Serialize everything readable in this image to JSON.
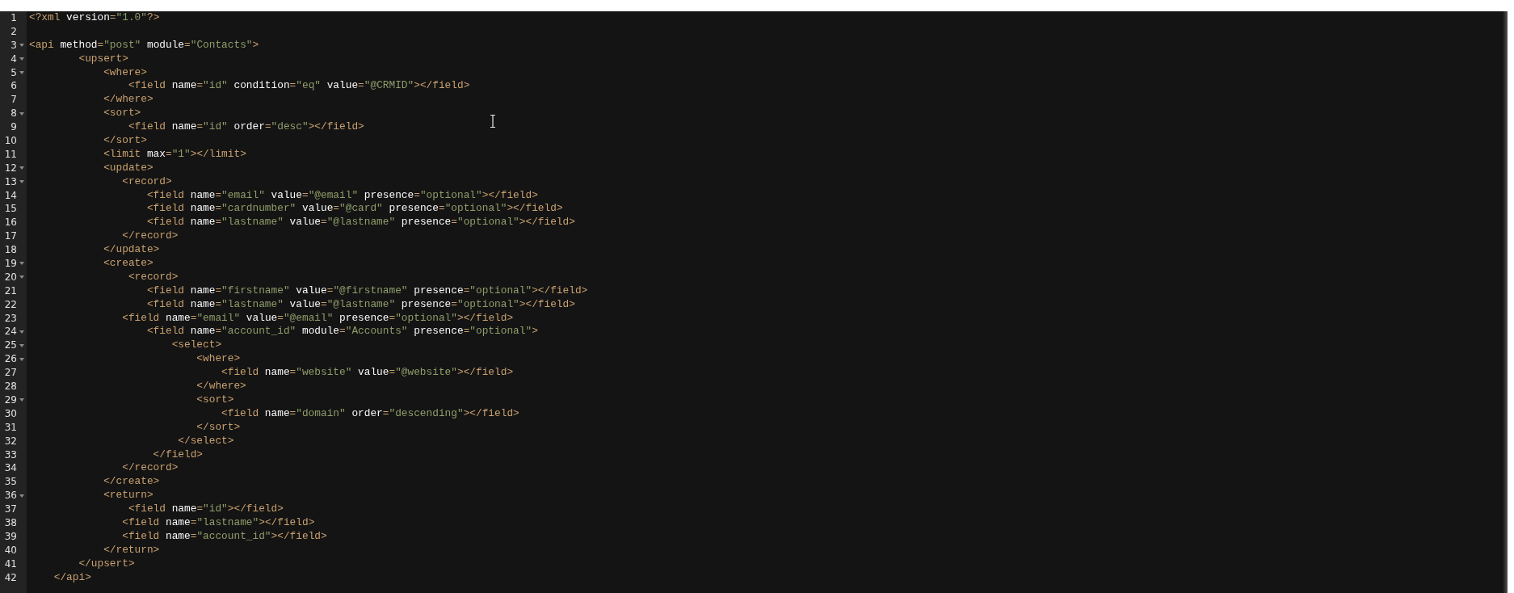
{
  "editor": {
    "lines": [
      {
        "number": "1",
        "text": "<?xml version=\"1.0\"?>",
        "foldable": false
      },
      {
        "number": "2",
        "foldable": false
      },
      {
        "number": "3",
        "text": "<api method=\"post\" module=\"Contacts\">",
        "foldable": true
      },
      {
        "number": "4",
        "text": "        <upsert>",
        "foldable": true
      },
      {
        "number": "5",
        "text": "            <where>",
        "foldable": true
      },
      {
        "number": "6",
        "text": "                <field name=\"id\" condition=\"eq\" value=\"@CRMID\"></field>",
        "foldable": false
      },
      {
        "number": "7",
        "text": "            </where>",
        "foldable": false
      },
      {
        "number": "8",
        "text": "            <sort>",
        "foldable": true
      },
      {
        "number": "9",
        "text": "                <field name=\"id\" order=\"desc\"></field>",
        "foldable": false
      },
      {
        "number": "10",
        "text": "            </sort>",
        "foldable": false
      },
      {
        "number": "11",
        "text": "            <limit max=\"1\"></limit>",
        "foldable": false
      },
      {
        "number": "12",
        "text": "            <update>",
        "foldable": true
      },
      {
        "number": "13",
        "text": "               <record>",
        "foldable": true
      },
      {
        "number": "14",
        "text": "                   <field name=\"email\" value=\"@email\" presence=\"optional\"></field>",
        "foldable": false
      },
      {
        "number": "15",
        "text": "                   <field name=\"cardnumber\" value=\"@card\" presence=\"optional\"></field>",
        "foldable": false
      },
      {
        "number": "16",
        "text": "                   <field name=\"lastname\" value=\"@lastname\" presence=\"optional\"></field>",
        "foldable": false
      },
      {
        "number": "17",
        "text": "               </record>",
        "foldable": false
      },
      {
        "number": "18",
        "text": "            </update>",
        "foldable": false
      },
      {
        "number": "19",
        "text": "            <create>",
        "foldable": true
      },
      {
        "number": "20",
        "text": "                <record>",
        "foldable": true
      },
      {
        "number": "21",
        "text": "                   <field name=\"firstname\" value=\"@firstname\" presence=\"optional\"></field>",
        "foldable": false
      },
      {
        "number": "22",
        "text": "                   <field name=\"lastname\" value=\"@lastname\" presence=\"optional\"></field>",
        "foldable": false
      },
      {
        "number": "23",
        "text": "               <field name=\"email\" value=\"@email\" presence=\"optional\"></field>",
        "foldable": false
      },
      {
        "number": "24",
        "text": "                   <field name=\"account_id\" module=\"Accounts\" presence=\"optional\">",
        "foldable": true
      },
      {
        "number": "25",
        "text": "                       <select>",
        "foldable": true
      },
      {
        "number": "26",
        "text": "                           <where>",
        "foldable": true
      },
      {
        "number": "27",
        "text": "                               <field name=\"website\" value=\"@website\"></field>",
        "foldable": false
      },
      {
        "number": "28",
        "text": "                           </where>",
        "foldable": false
      },
      {
        "number": "29",
        "text": "                           <sort>",
        "foldable": true
      },
      {
        "number": "30",
        "text": "                               <field name=\"domain\" order=\"descending\"></field>",
        "foldable": false
      },
      {
        "number": "31",
        "text": "                           </sort>",
        "foldable": false
      },
      {
        "number": "32",
        "text": "                        </select>",
        "foldable": false
      },
      {
        "number": "33",
        "text": "                    </field>",
        "foldable": false
      },
      {
        "number": "34",
        "text": "               </record>",
        "foldable": false
      },
      {
        "number": "35",
        "text": "            </create>",
        "foldable": false
      },
      {
        "number": "36",
        "text": "            <return>",
        "foldable": true
      },
      {
        "number": "37",
        "text": "                <field name=\"id\"></field>",
        "foldable": false
      },
      {
        "number": "38",
        "text": "               <field name=\"lastname\"></field>",
        "foldable": false
      },
      {
        "number": "39",
        "text": "               <field name=\"account_id\"></field>",
        "foldable": false
      },
      {
        "number": "40",
        "text": "            </return>",
        "foldable": false
      },
      {
        "number": "41",
        "text": "        </upsert>",
        "foldable": false
      },
      {
        "number": "42",
        "text": "    </api>",
        "foldable": false
      }
    ]
  }
}
